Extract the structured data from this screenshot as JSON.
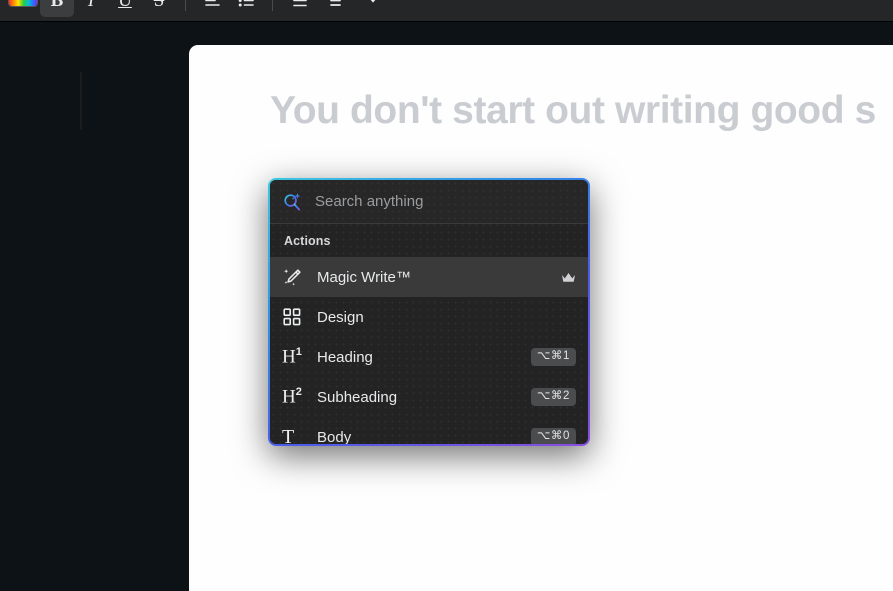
{
  "toolbar": {
    "items": [
      {
        "name": "text-color-swatch",
        "icon": "rainbow-color-swatch",
        "label": "Text color",
        "active": false
      },
      {
        "name": "bold-button",
        "icon": "bold-icon",
        "label": "B",
        "active": true
      },
      {
        "name": "italic-button",
        "icon": "italic-icon",
        "label": "I",
        "active": false
      },
      {
        "name": "underline-button",
        "icon": "underline-icon",
        "label": "U",
        "active": false
      },
      {
        "name": "strikethrough-button",
        "icon": "strikethrough-icon",
        "label": "S",
        "active": false
      },
      {
        "name": "align-button",
        "icon": "align-left-icon",
        "label": "Align",
        "active": false
      },
      {
        "name": "bullet-list-button",
        "icon": "bullet-list-icon",
        "label": "Bullet list",
        "active": false
      },
      {
        "name": "spacing-button",
        "icon": "line-spacing-icon",
        "label": "Spacing",
        "active": false
      },
      {
        "name": "numbered-list-button",
        "icon": "numbered-list-icon",
        "label": "Numbered list",
        "active": false
      },
      {
        "name": "more-options-button",
        "icon": "chevron-down-icon",
        "label": "More",
        "active": false
      }
    ]
  },
  "document": {
    "title_text": "You don't start out writing good s"
  },
  "palette": {
    "search": {
      "placeholder": "Search anything",
      "value": "",
      "icon": "search-sparkle-icon"
    },
    "section_label": "Actions",
    "items": [
      {
        "label": "Magic Write™",
        "icon": "magic-wand-pencil-icon",
        "shortcut": "",
        "badge": "crown-icon",
        "selected": true,
        "name": "magic-write"
      },
      {
        "label": "Design",
        "icon": "grid-squares-icon",
        "shortcut": "",
        "badge": "",
        "selected": false,
        "name": "design"
      },
      {
        "label": "Heading",
        "icon": "heading-one-icon",
        "shortcut": "⌥⌘1",
        "badge": "",
        "selected": false,
        "name": "heading"
      },
      {
        "label": "Subheading",
        "icon": "heading-two-icon",
        "shortcut": "⌥⌘2",
        "badge": "",
        "selected": false,
        "name": "subheading"
      },
      {
        "label": "Body",
        "icon": "text-body-icon",
        "shortcut": "⌥⌘0",
        "badge": "",
        "selected": false,
        "name": "body"
      }
    ]
  },
  "colors": {
    "app_background": "#0d1217",
    "toolbar_background": "#252627",
    "page_background": "#fefefe",
    "palette_background": "#232323",
    "palette_selected_row": "#3a3a3a",
    "gradient_start": "#3ec8e0",
    "gradient_mid": "#2f8fe8",
    "gradient_end": "#8a4fe0",
    "title_text_color": "#c9ccd1"
  }
}
